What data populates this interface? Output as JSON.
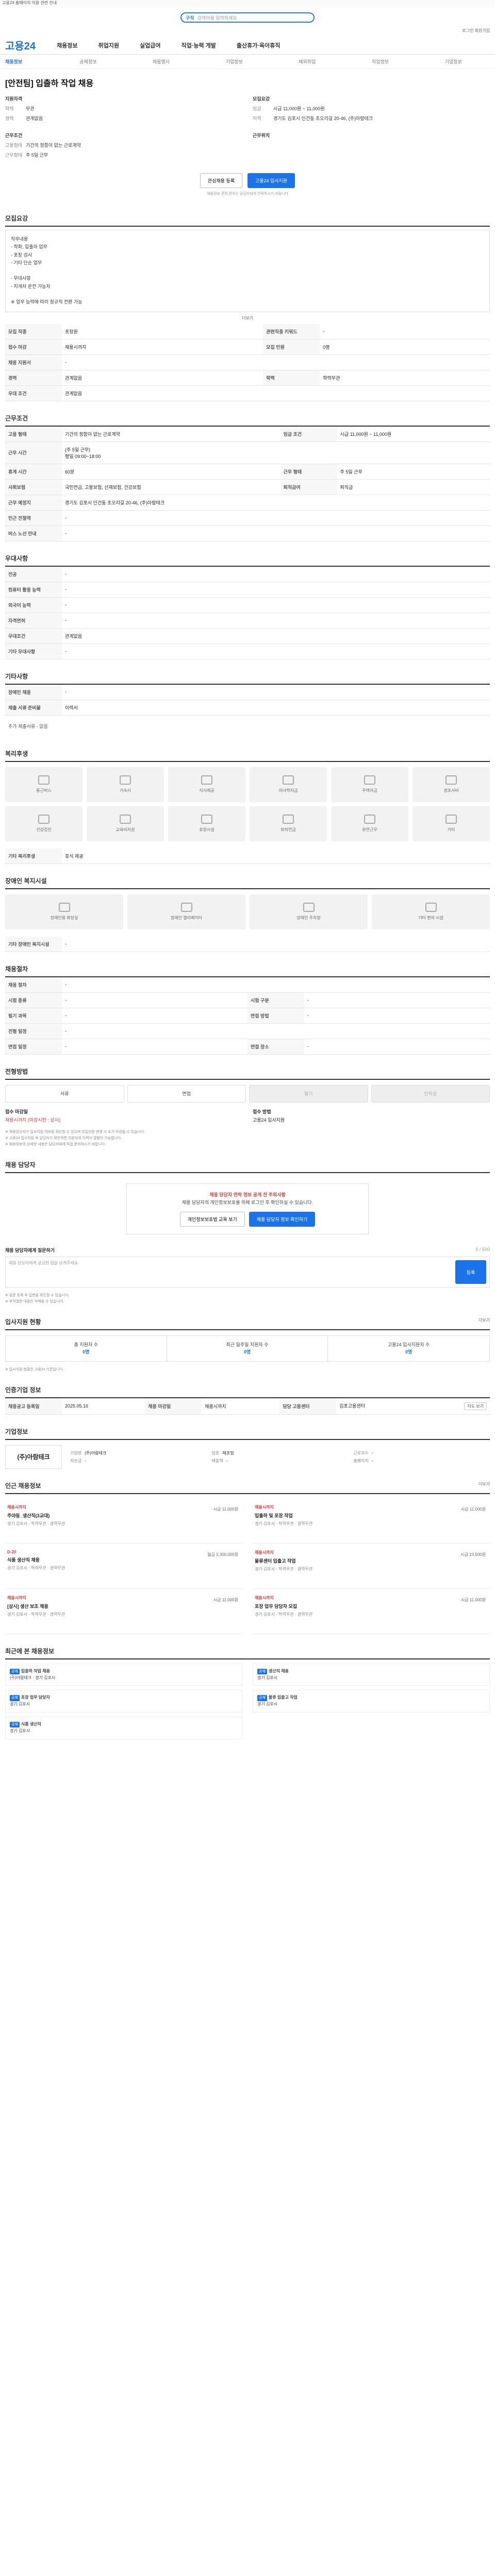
{
  "top_notice": "고용24 홈페이지 이용 관련 안내",
  "search": {
    "label": "구직",
    "placeholder": "검색어를 입력하세요"
  },
  "util": "로그인  회원가입",
  "gnb": {
    "logo": "고용24",
    "menu": [
      "채용정보",
      "취업지원",
      "실업급여",
      "직업·능력 개발",
      "출산휴가·육아휴직"
    ]
  },
  "subnav": {
    "current": "채용정보",
    "items": [
      "공채정보",
      "채용행사",
      "기업정보",
      "해외취업",
      "직업정보",
      "기업정보"
    ]
  },
  "job": {
    "title": "[안전팀] 입출하 작업 채용",
    "left": [
      {
        "k": "학력",
        "v": "무관"
      },
      {
        "k": "경력",
        "v": "관계없음"
      },
      {
        "k": "고용형태",
        "v": "기간의 정함이 없는 근로계약"
      },
      {
        "k": "근무형태",
        "v": "주 5일 근무"
      }
    ],
    "right": [
      {
        "k": "임금",
        "v": "시급 11,000원 ~ 11,000원"
      },
      {
        "k": "지역",
        "v": "경기도 김포시 인건동 초오리길 20-46, (주)아람테크"
      }
    ],
    "left_heads": [
      "지원자격",
      "근무조건"
    ],
    "right_heads": [
      "모집요강",
      "근무위치"
    ]
  },
  "actions": {
    "save": "관심채용 등록",
    "apply": "고용24 입사지원",
    "note": "채용정보 관련 문의는 담당자에게 연락하시기 바랍니다"
  },
  "recruit": {
    "title": "모집요강",
    "body": [
      "직무내용",
      "- 착화, 입출하 업무",
      "- 포장 검사",
      "- 기타 단순 업무",
      "",
      "- 우대사항",
      "- 지게차 운전 가능자",
      "",
      "※ 업무 능력에 따라 정규직 전환 가능"
    ],
    "more": "더보기",
    "rows": [
      {
        "th": "모집 직종",
        "td": "포장원",
        "th2": "관련직종 키워드",
        "td2": "-"
      },
      {
        "th": "접수 마감",
        "td": "채용시까지",
        "th2": "모집 인원",
        "td2": "0명"
      },
      {
        "th": "채용 지원서",
        "td": "-",
        "th2": "",
        "td2": ""
      },
      {
        "th": "경력",
        "td": "관계없음",
        "th2": "학력",
        "td2": "학력무관"
      },
      {
        "th": "우대 조건",
        "td": "관계없음",
        "th2": "",
        "td2": ""
      }
    ]
  },
  "conditions": {
    "title": "근무조건",
    "rows": [
      {
        "th": "고용 형태",
        "td": "기간의 정함이 없는 근로계약",
        "th2": "임금 조건",
        "td2": "시급 11,000원 ~ 11,000원"
      },
      {
        "th": "근무 시간",
        "td": "(주 5일 근무)\n평일 09:00~18:00",
        "th2": "",
        "td2": ""
      },
      {
        "th": "휴게 시간",
        "td": "60분",
        "th2": "근무 형태",
        "td2": "주 5일 근무"
      },
      {
        "th": "사회보험",
        "td": "국민연금, 고용보험, 산재보험, 건강보험",
        "th2": "퇴직금여",
        "td2": "퇴직금"
      },
      {
        "th": "근무 예정지",
        "td": "경기도 김포시 인건동 초오리길 20-46, (주)아람테크",
        "th2": "",
        "td2": ""
      },
      {
        "th": "인근 전철역",
        "td": "-",
        "th2": "",
        "td2": ""
      },
      {
        "th": "버스 노선 안내",
        "td": "-",
        "th2": "",
        "td2": ""
      }
    ],
    "map_chip": "지도 보기"
  },
  "qualifications": {
    "title": "우대사항",
    "rows": [
      {
        "th": "전공",
        "td": "-"
      },
      {
        "th": "컴퓨터 활용 능력",
        "td": "-"
      },
      {
        "th": "외국어 능력",
        "td": "-"
      },
      {
        "th": "자격면허",
        "td": "-"
      },
      {
        "th": "우대조건",
        "td": "관계없음"
      },
      {
        "th": "기타 우대사항",
        "td": "-"
      }
    ]
  },
  "other": {
    "title": "기타사항",
    "rows": [
      {
        "th": "장애인 채용",
        "td": "-"
      },
      {
        "th": "제출 서류 준비물",
        "td": "이력서"
      }
    ],
    "note": "추가 제출서류 - 없음"
  },
  "welfare": {
    "title": "복리후생",
    "items": [
      "통근버스",
      "기숙사",
      "식사제공",
      "자녀학자금",
      "주택자금",
      "경조사비",
      "건강검진",
      "교육비지원",
      "휴양시설",
      "퇴직연금",
      "유연근무",
      "기타"
    ],
    "note_head": "기타 복리후생",
    "note": "휴식 제공"
  },
  "disabled": {
    "title": "장애인 복지시설",
    "items": [
      "장애인용 화장실",
      "장애인 엘리베이터",
      "장애인 주차장",
      "기타 편의 시설"
    ],
    "note_head": "기타 장애인 복지시설",
    "note": "-"
  },
  "worktime": {
    "title": "채용절차",
    "rows": [
      {
        "th": "채용 절차",
        "td": "-",
        "th2": "",
        "td2": ""
      },
      {
        "th": "시험 종류",
        "td": "-",
        "th2": "시험 구분",
        "td2": "-"
      },
      {
        "th": "필기 과목",
        "td": "-",
        "th2": "면접 방법",
        "td2": "-"
      },
      {
        "th": "전형 일정",
        "td": "-",
        "th2": "",
        "td2": ""
      },
      {
        "th": "면접 일정",
        "td": "-",
        "th2": "면접 장소",
        "td2": "-"
      }
    ]
  },
  "process": {
    "title": "전형방법",
    "steps": [
      "서류",
      "면접",
      "필기",
      "인적성"
    ],
    "apply_head1": "접수 마감일",
    "apply_val1": "채용시까지 (마감시한 : 상시)",
    "apply_head2": "접수 방법",
    "apply_val2": "고용24 입사지원",
    "apply_red": "채용시까지",
    "notes": [
      "※ 채용담당자가 입사지원 여부를 확인할 수 있으며 모집인원 변경 시 조기 마감될 수 있습니다.",
      "※ 고용24 입사지원 후 담당자가 확인하면 지원자의 이력서 열람이 가능합니다.",
      "※ 채용정보의 상세한 내용은 담당자에게 직접 문의하시기 바랍니다."
    ]
  },
  "contact": {
    "title": "채용 담당자",
    "warn": "채용 담당자 연락 정보 공개 전 주의사항",
    "body": "채용 담당자의 개인정보보호를 위해 로그인 후 확인하실 수 있습니다.",
    "btn1": "개인정보보호법 교육 보기",
    "btn2": "채용 담당자 정보 확인하기"
  },
  "qa": {
    "title": "채용 담당자에게 질문하기",
    "counter": "0 / 500",
    "placeholder": "채용 담당자에게 궁금한 점을 남겨주세요.",
    "btn": "등록",
    "notes": [
      "※ 질문 등록 후 답변을 확인할 수 있습니다.",
      "※ 부적절한 내용은 삭제될 수 있습니다."
    ]
  },
  "stats": {
    "title": "입사지원 현황",
    "more": "더보기",
    "items": [
      {
        "label": "총 지원자 수",
        "val": "0명"
      },
      {
        "label": "최근 일주일 지원자 수",
        "val": "0명"
      },
      {
        "label": "고용24 입사지원자 수",
        "val": "0명"
      }
    ],
    "note": "※ 입사지원 현황은 고용24 기준입니다."
  },
  "reg": {
    "title": "인증기업 정보",
    "rows": [
      {
        "th": "채용공고 등록일",
        "td": "2025.05.16",
        "th2": "채용 마감일",
        "td2": "채용시까지",
        "th3": "담당 고용센터",
        "td3": "김포고용센터"
      }
    ],
    "chip": "지도 보기"
  },
  "company": {
    "title": "기업정보",
    "logo": "(주)아람테크",
    "fields": [
      {
        "k": "기업명",
        "v": "(주)아람테크"
      },
      {
        "k": "업종",
        "v": "제조업"
      },
      {
        "k": "근로자수",
        "v": "-"
      },
      {
        "k": "자본금",
        "v": "-"
      },
      {
        "k": "매출액",
        "v": "-"
      },
      {
        "k": "홈페이지",
        "v": "-"
      }
    ]
  },
  "related": {
    "title": "인근 채용정보",
    "more": "더보기",
    "items": [
      {
        "badge": "채용시까지",
        "title": "주야동_생산직(3교대)",
        "meta": "경기 김포시 · 학력무관 · 경력무관",
        "right": "시급 11,000원"
      },
      {
        "badge": "채용시까지",
        "title": "입출하 및 포장 작업",
        "meta": "경기 김포시 · 학력무관 · 경력무관",
        "right": "시급 11,000원"
      },
      {
        "badge": "D-20",
        "title": "식품 생산직 채용",
        "meta": "경기 김포시 · 학력무관 · 경력무관",
        "right": "월급 2,300,000원"
      },
      {
        "badge": "채용시까지",
        "title": "물류센터 입출고 작업",
        "meta": "경기 김포시 · 학력무관 · 경력무관",
        "right": "시급 10,500원"
      },
      {
        "badge": "채용시까지",
        "title": "[상시] 생산 보조 채용",
        "meta": "경기 김포시 · 학력무관 · 경력무관",
        "right": "시급 11,000원"
      },
      {
        "badge": "채용시까지",
        "title": "포장 업무 담당자 모집",
        "meta": "경기 김포시 · 학력무관 · 경력무관",
        "right": "시급 11,000원"
      }
    ]
  },
  "recent": {
    "title": "최근에 본 채용정보",
    "items": [
      {
        "tag": "공채",
        "title": "입출하 작업 채용",
        "meta": "(주)아람테크 · 경기 김포시"
      },
      {
        "tag": "공채",
        "title": "생산직 채용",
        "meta": "경기 김포시"
      },
      {
        "tag": "공채",
        "title": "포장 업무 담당자",
        "meta": "경기 김포시"
      },
      {
        "tag": "공채",
        "title": "물류 입출고 작업",
        "meta": "경기 김포시"
      },
      {
        "tag": "공채",
        "title": "식품 생산직",
        "meta": "경기 김포시"
      }
    ]
  }
}
